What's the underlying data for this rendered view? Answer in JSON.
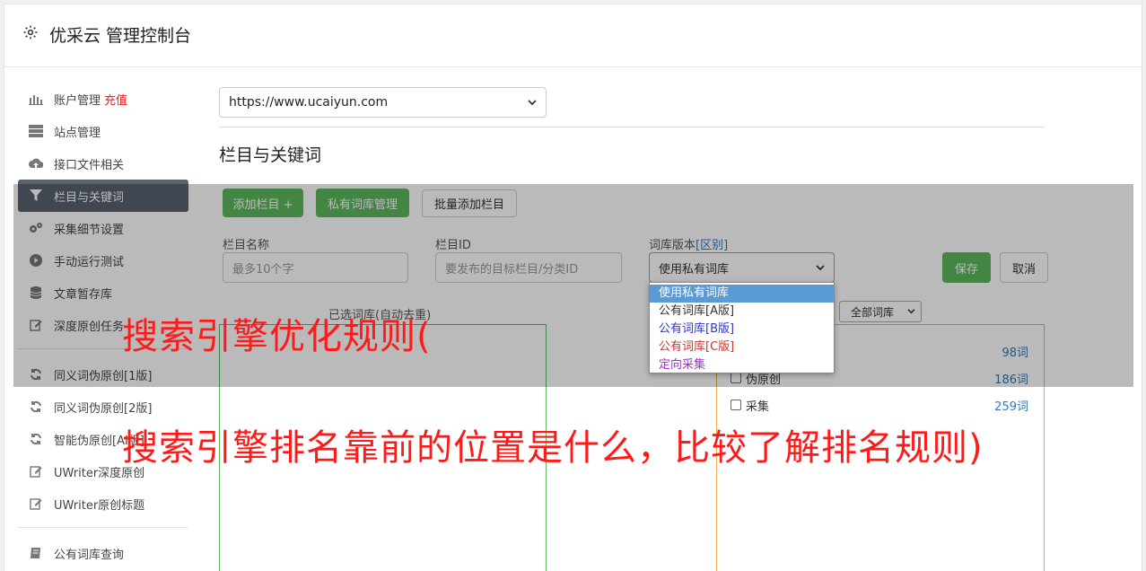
{
  "header": {
    "title": "优采云 管理控制台",
    "icon": "gear-icon"
  },
  "sidebar": {
    "items": [
      {
        "label": "账户管理",
        "badge": "充值",
        "icon": "bar-chart-icon"
      },
      {
        "label": "站点管理",
        "icon": "server-icon"
      },
      {
        "label": "接口文件相关",
        "icon": "cloud-upload-icon"
      },
      {
        "label": "栏目与关键词",
        "icon": "filter-icon",
        "active": true
      },
      {
        "label": "采集细节设置",
        "icon": "cogs-icon"
      },
      {
        "label": "手动运行测试",
        "icon": "play-circle-icon"
      },
      {
        "label": "文章暂存库",
        "icon": "database-icon"
      },
      {
        "label": "深度原创任务",
        "icon": "edit-icon"
      },
      {
        "label": "同义词伪原创[1版]",
        "icon": "refresh-icon"
      },
      {
        "label": "同义词伪原创[2版]",
        "icon": "refresh-icon"
      },
      {
        "label": "智能伪原创[AI版]",
        "icon": "refresh-icon"
      },
      {
        "label": "UWriter深度原创",
        "icon": "edit-icon"
      },
      {
        "label": "UWriter原创标题",
        "icon": "edit-icon"
      },
      {
        "label": "公有词库查询",
        "icon": "book-icon"
      }
    ]
  },
  "main": {
    "site_select": "https://www.ucaiyun.com",
    "section_title": "栏目与关键词",
    "buttons": {
      "add_column": "添加栏目 +",
      "private_lib": "私有词库管理",
      "batch_add": "批量添加栏目",
      "save": "保存",
      "cancel": "取消"
    },
    "form": {
      "column_name_label": "栏目名称",
      "column_name_placeholder": "最多10个字",
      "column_id_label": "栏目ID",
      "column_id_placeholder": "要发布的目标栏目/分类ID",
      "lib_version_label": "词库版本",
      "lib_version_link": "[区别]",
      "lib_version_value": "使用私有词库"
    },
    "dropdown_options": [
      {
        "label": "使用私有词库",
        "color": "#ffffff",
        "selected": true
      },
      {
        "label": "公有词库[A版]",
        "color": "#333333"
      },
      {
        "label": "公有词库[B版]",
        "color": "#3333cc"
      },
      {
        "label": "公有词库[C版]",
        "color": "#cc3333"
      },
      {
        "label": "定向采集",
        "color": "#9933cc"
      }
    ],
    "left_panel_title": "已选词库(自动去重)",
    "lib_filter": "全部词库",
    "right_rows": [
      {
        "label": "",
        "count": "98词"
      },
      {
        "label": "伪原创",
        "count": "186词"
      },
      {
        "label": "采集",
        "count": "259词"
      }
    ]
  },
  "overlay_text": {
    "line1": "搜索引擎优化规则(",
    "line2": "搜索引擎排名靠前的位置是什么，比较了解排名规则)"
  }
}
